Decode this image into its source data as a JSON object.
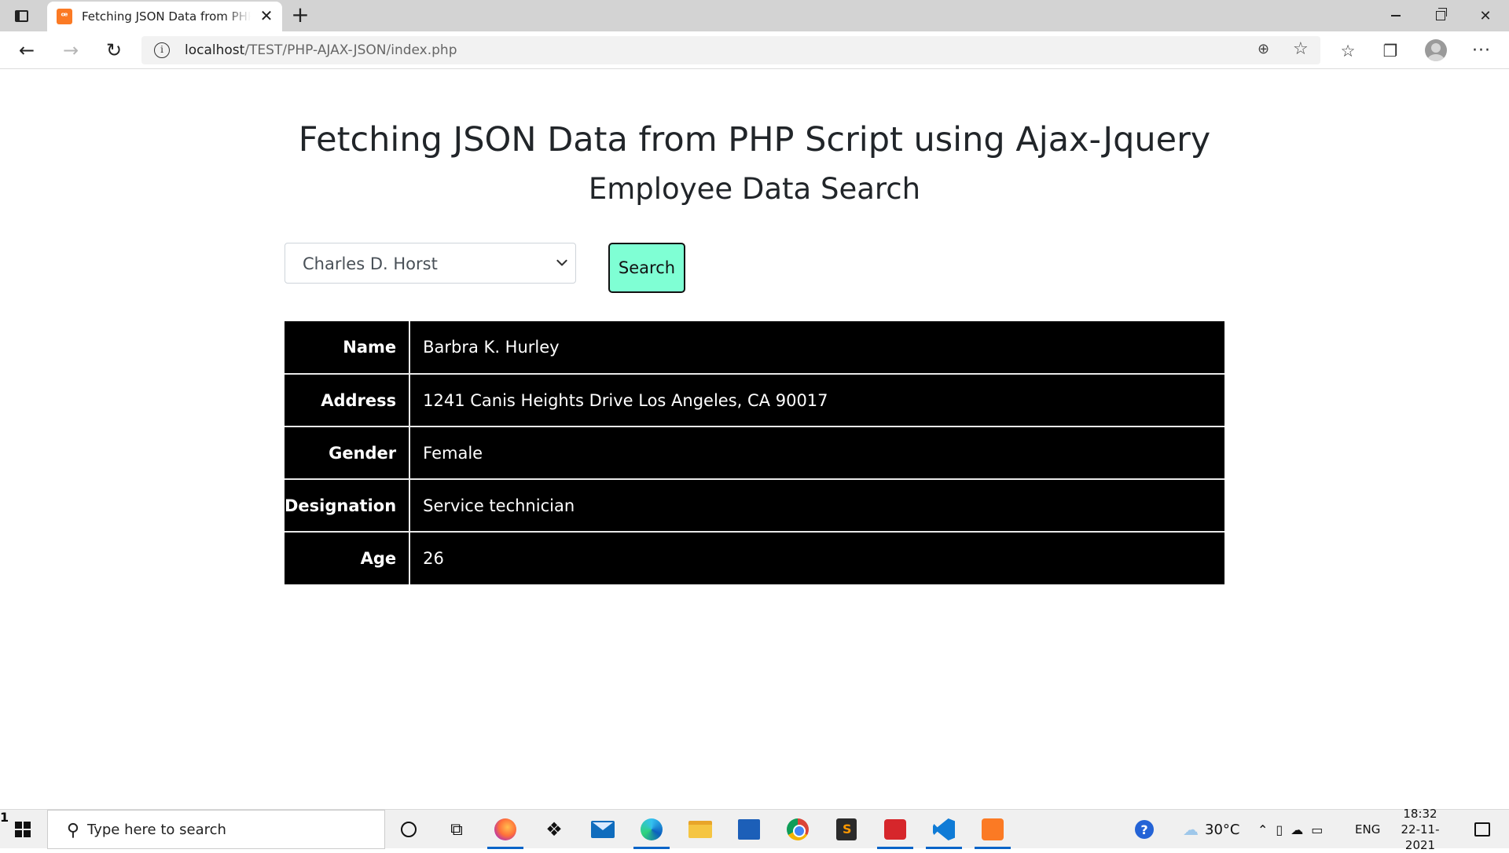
{
  "browser": {
    "tab_title": "Fetching JSON Data from PHP Script using Ajax-Jquery",
    "tab_close": "✕",
    "new_tab": "+",
    "url_host": "localhost",
    "url_path": "/TEST/PHP-AJAX-JSON/index.php"
  },
  "page": {
    "heading": "Fetching JSON Data from PHP Script using Ajax-Jquery",
    "subheading": "Employee Data Search",
    "select_value": "Charles D. Horst",
    "search_label": "Search",
    "table": [
      {
        "label": "Name",
        "value": "Barbra K. Hurley"
      },
      {
        "label": "Address",
        "value": "1241 Canis Heights Drive Los Angeles, CA 90017"
      },
      {
        "label": "Gender",
        "value": "Female"
      },
      {
        "label": "Designation",
        "value": "Service technician"
      },
      {
        "label": "Age",
        "value": "26"
      }
    ]
  },
  "taskbar": {
    "search_placeholder": "Type here to search",
    "temperature": "30°C",
    "language": "ENG",
    "time": "18:32",
    "date": "22-11-2021",
    "notification_count": "1",
    "apps": [
      "cortana-icon",
      "task-view-icon",
      "firefox-icon",
      "dropbox-icon",
      "mail-icon",
      "edge-icon",
      "file-explorer-icon",
      "store-icon",
      "chrome-icon",
      "sublime-text-icon",
      "red-app-icon",
      "vscode-icon",
      "xampp-icon"
    ]
  },
  "colors": {
    "search_button_bg": "#7fffd4",
    "table_bg": "#000000",
    "accent": "#0a64c8"
  }
}
